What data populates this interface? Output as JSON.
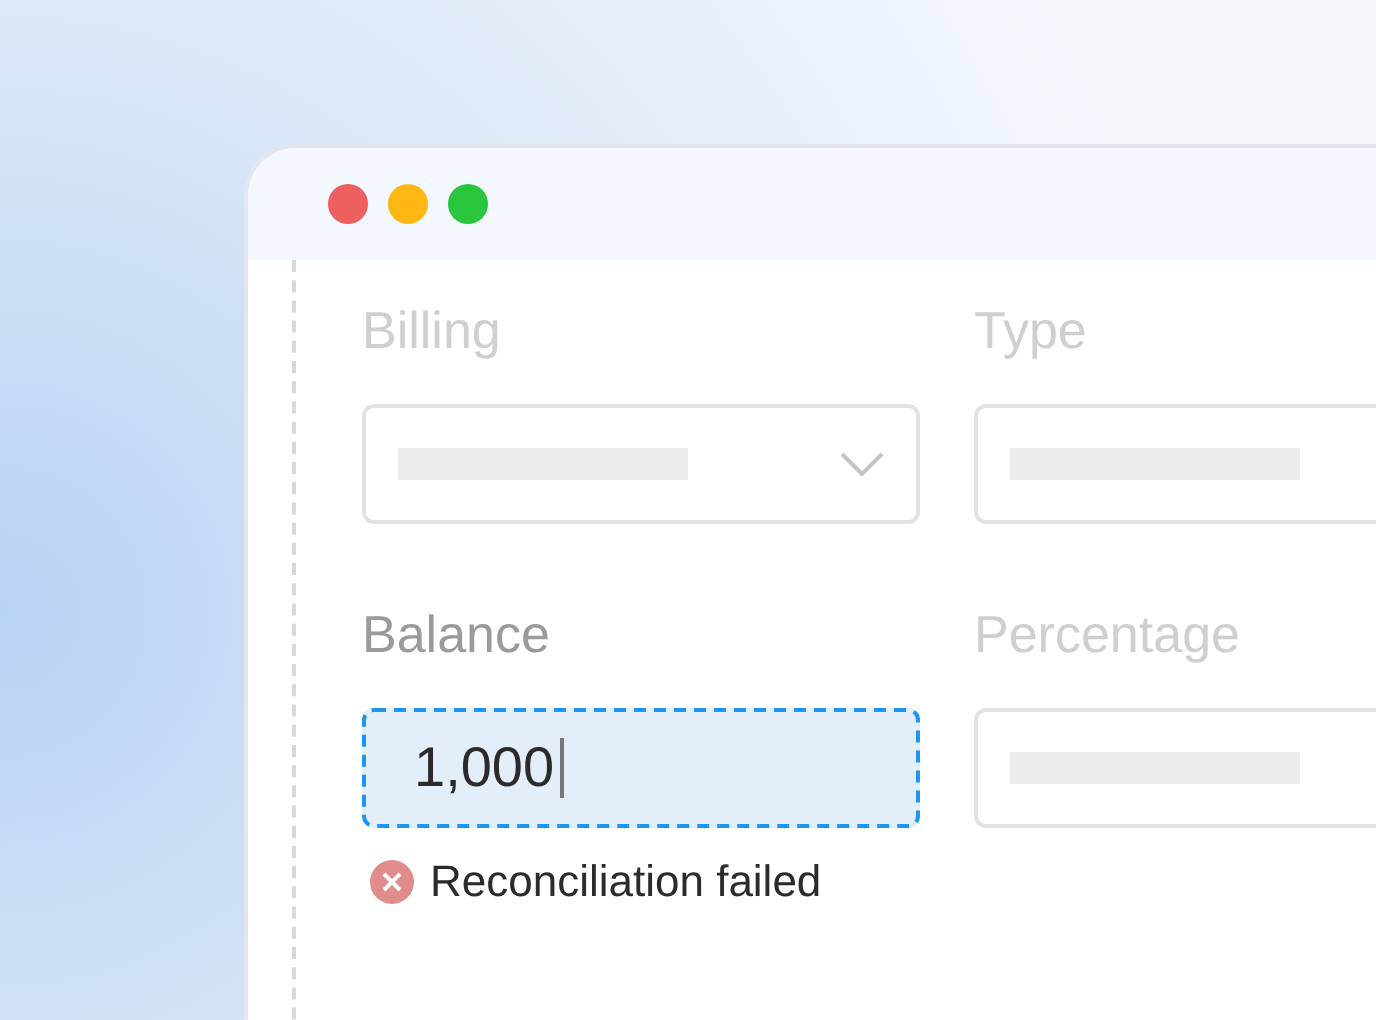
{
  "window": {
    "controls": [
      {
        "color": "#ee5f5f"
      },
      {
        "color": "#fdb612"
      },
      {
        "color": "#29c63d"
      }
    ]
  },
  "fields": [
    {
      "label": "Billing",
      "kind": "select",
      "focused": false
    },
    {
      "label": "Type",
      "kind": "text",
      "focused": false
    },
    {
      "label": "Balance",
      "kind": "text",
      "focused": true,
      "value": "1,000",
      "error": "Reconciliation failed"
    },
    {
      "label": "Percentage",
      "kind": "text",
      "focused": false
    }
  ]
}
